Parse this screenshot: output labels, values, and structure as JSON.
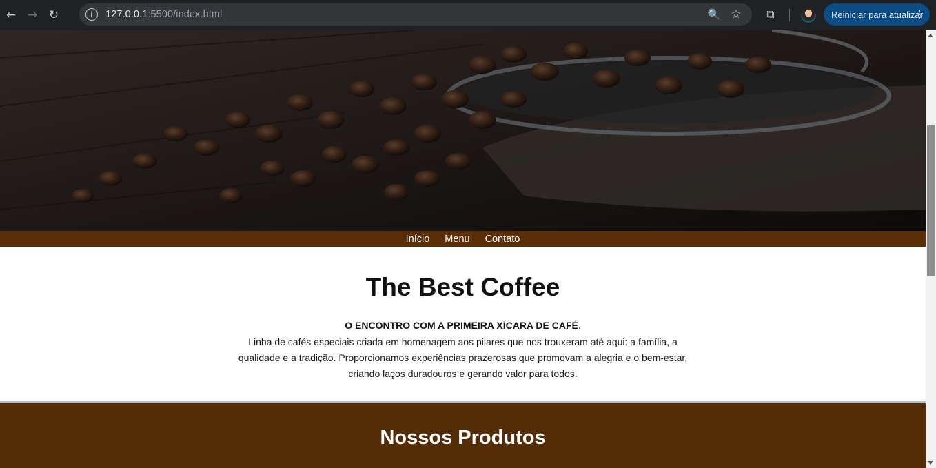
{
  "browser": {
    "back_icon": "←",
    "forward_icon": "→",
    "reload_icon": "↻",
    "site_info_icon": "i",
    "url_host": "127.0.0.1",
    "url_path": ":5500/index.html",
    "zoom_icon": "🔍",
    "star_icon": "☆",
    "extensions_icon": "⧉",
    "update_label": "Reiniciar para atualizar",
    "menu_icon": "⋮"
  },
  "nav": {
    "items": [
      "Início",
      "Menu",
      "Contato"
    ]
  },
  "intro": {
    "title": "The Best Coffee",
    "tagline_bold": "O ENCONTRO COM A PRIMEIRA XÍCARA DE CAFÉ",
    "tagline_end": ".",
    "description": "Linha de cafés especiais criada em homenagem aos pilares que nos trouxeram até aqui: a família, a qualidade e a tradição. Proporcionamos experiências prazerosas que promovam a alegria e o bem-estar, criando laços duradouros e gerando valor para todos."
  },
  "products": {
    "title": "Nossos Produtos"
  },
  "colors": {
    "nav_bg": "#5a2f08",
    "products_bg": "#542d07",
    "update_button": "#0b4c85"
  }
}
